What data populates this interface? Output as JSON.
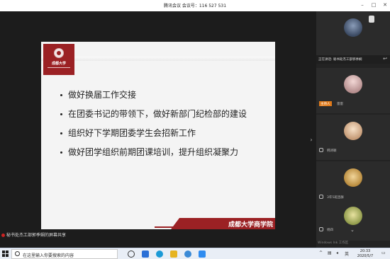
{
  "window": {
    "title": "腾讯会议 会议号：116 527 531",
    "minimize_glyph": "–",
    "maximize_glyph": "□",
    "close_glyph": "✕"
  },
  "slide": {
    "logo_text": "成都大学",
    "bullets": [
      "做好换届工作交接",
      "在团委书记的带领下，做好新部门纪检部的建设",
      "组织好下学期团委学生会招新工作",
      "做好团学组织前期团课培训，提升组织凝聚力"
    ],
    "footer": "成都大学商学院",
    "accent": "#9b2124"
  },
  "share_note": "秘书处杰工部郭季娴的屏幕共享",
  "panel": {
    "speaking_label": "正在讲话: 秘书处杰工部郭季娴",
    "participants": [
      {
        "name": "",
        "badge": ""
      },
      {
        "name": "雷雷",
        "badge": "主持人"
      },
      {
        "name": "韩诗颖",
        "badge": ""
      },
      {
        "name": "3年5班团群",
        "badge": ""
      },
      {
        "name": "杨四",
        "badge": ""
      }
    ],
    "watermark": "Windows Ink 工作区"
  },
  "taskbar": {
    "search_placeholder": "在这里输入你要搜索的内容",
    "time": "20:33",
    "date": "2020/5/7"
  }
}
